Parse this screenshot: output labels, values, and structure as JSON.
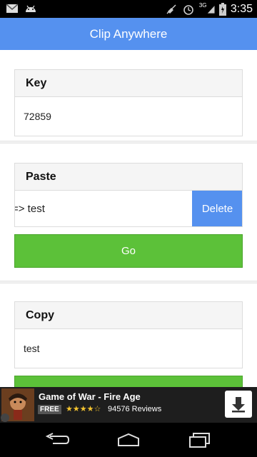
{
  "status_bar": {
    "time": "3:35",
    "network": "3G",
    "icons": [
      "email-icon",
      "android-icon",
      "mute-icon",
      "alarm-icon",
      "signal-icon",
      "battery-icon"
    ]
  },
  "app_bar": {
    "title": "Clip Anywhere"
  },
  "key_section": {
    "header": "Key",
    "value": "72859"
  },
  "paste_section": {
    "header": "Paste",
    "input_value": "=> test",
    "delete_label": "Delete",
    "go_label": "Go"
  },
  "copy_section": {
    "header": "Copy",
    "value": "test"
  },
  "ad": {
    "title": "Game of War - Fire Age",
    "free_badge": "FREE",
    "stars": "★★★★☆",
    "rating": 4,
    "reviews": "94576 Reviews"
  },
  "colors": {
    "app_bar": "#5591ef",
    "go_button": "#5cc139",
    "delete_button": "#5591ef"
  }
}
